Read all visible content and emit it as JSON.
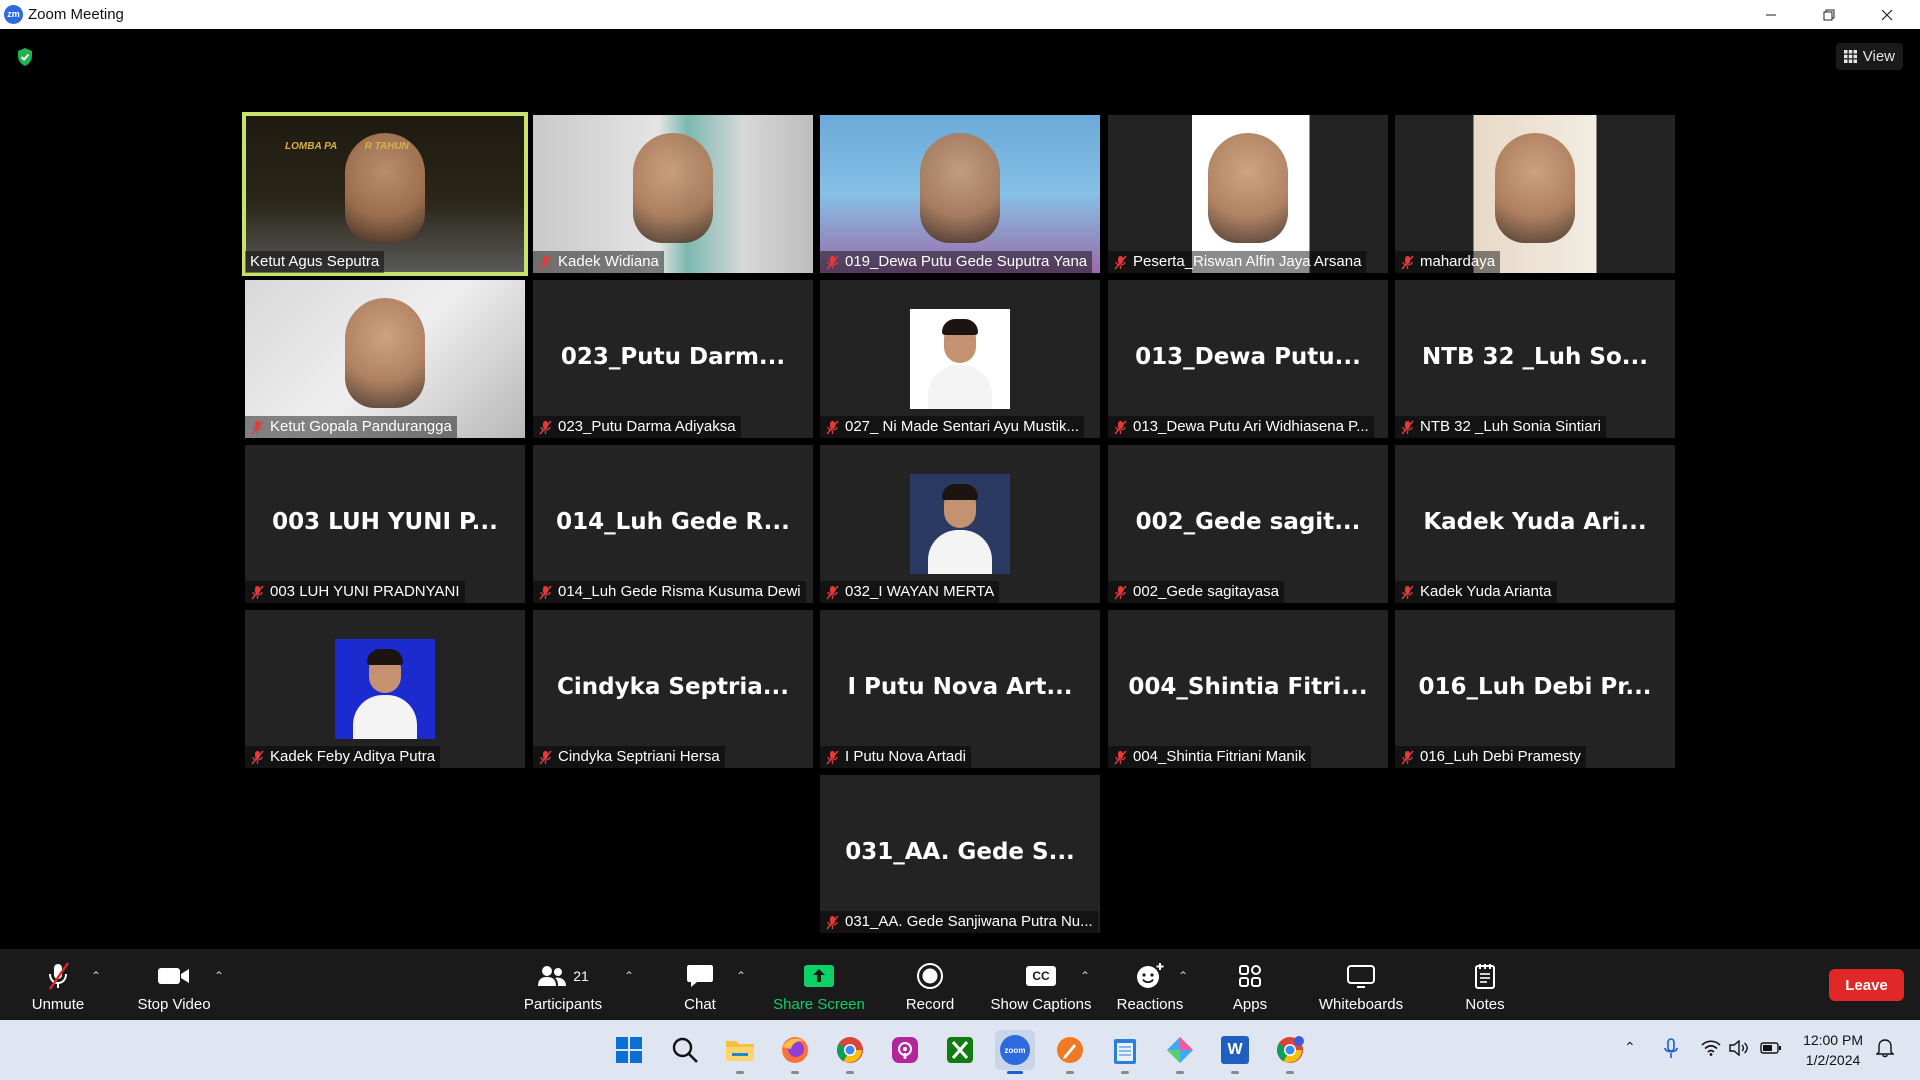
{
  "window": {
    "title": "Zoom Meeting",
    "app_logo_text": "zm"
  },
  "view_button": {
    "label": "View"
  },
  "tiles": [
    {
      "label": "Ketut Agus Seputra",
      "big": "",
      "video": true,
      "active": true,
      "video_text": "LOMBA PA          R TAHUN"
    },
    {
      "label": "Kadek Widiana",
      "big": "",
      "video": true
    },
    {
      "label": "019_Dewa Putu Gede Suputra Yana",
      "big": "",
      "video": true
    },
    {
      "label": "Peserta_Riswan Alfin Jaya Arsana",
      "big": "",
      "video": true
    },
    {
      "label": "mahardaya",
      "big": "",
      "video": true
    },
    {
      "label": "Ketut Gopala Pandurangga",
      "big": "",
      "video": true
    },
    {
      "label": "023_Putu Darma Adiyaksa",
      "big": "023_Putu  Darm..."
    },
    {
      "label": "027_ Ni Made Sentari Ayu Mustik...",
      "big": "",
      "photo": true
    },
    {
      "label": "013_Dewa Putu Ari Widhiasena P...",
      "big": "013_Dewa  Putu..."
    },
    {
      "label": "NTB 32 _Luh Sonia Sintiari",
      "big": "NTB 32  _Luh So..."
    },
    {
      "label": "003 LUH YUNI PRADNYANI",
      "big": "003 LUH YUNI P..."
    },
    {
      "label": "014_Luh Gede Risma Kusuma Dewi",
      "big": "014_Luh Gede R..."
    },
    {
      "label": "032_I WAYAN MERTA",
      "big": "",
      "photo": true
    },
    {
      "label": "002_Gede sagitayasa",
      "big": "002_Gede  sagit..."
    },
    {
      "label": "Kadek Yuda Arianta",
      "big": "Kadek Yuda Ari..."
    },
    {
      "label": "Kadek Feby Aditya Putra",
      "big": "",
      "photo": true
    },
    {
      "label": "Cindyka Septriani Hersa",
      "big": "Cindyka  Septria..."
    },
    {
      "label": "I Putu Nova Artadi",
      "big": "I Putu Nova Art..."
    },
    {
      "label": "004_Shintia Fitriani Manik",
      "big": "004_Shintia  Fitri..."
    },
    {
      "label": "016_Luh Debi Pramesty",
      "big": "016_Luh Debi Pr..."
    },
    {
      "label": "031_AA. Gede Sanjiwana Putra Nu...",
      "big": "031_AA. Gede S..."
    }
  ],
  "toolbar": {
    "unmute": "Unmute",
    "stop_video": "Stop Video",
    "participants": "Participants",
    "participants_count": "21",
    "chat": "Chat",
    "share_screen": "Share Screen",
    "record": "Record",
    "show_captions": "Show Captions",
    "captions_icon_text": "CC",
    "reactions": "Reactions",
    "apps": "Apps",
    "whiteboards": "Whiteboards",
    "notes": "Notes",
    "leave": "Leave",
    "share_color": "#0bd167",
    "leave_color": "#e02828"
  },
  "taskbar": {
    "apps": [
      "windows-start",
      "search",
      "file-explorer",
      "firefox",
      "chrome",
      "podcasts",
      "xbox",
      "zoom",
      "pen-app",
      "notepad",
      "paint-app",
      "word",
      "chrome-profile"
    ],
    "time": "12:00 PM",
    "date": "1/2/2024",
    "zoom_icon_text": "zoom",
    "word_icon_text": "W"
  }
}
